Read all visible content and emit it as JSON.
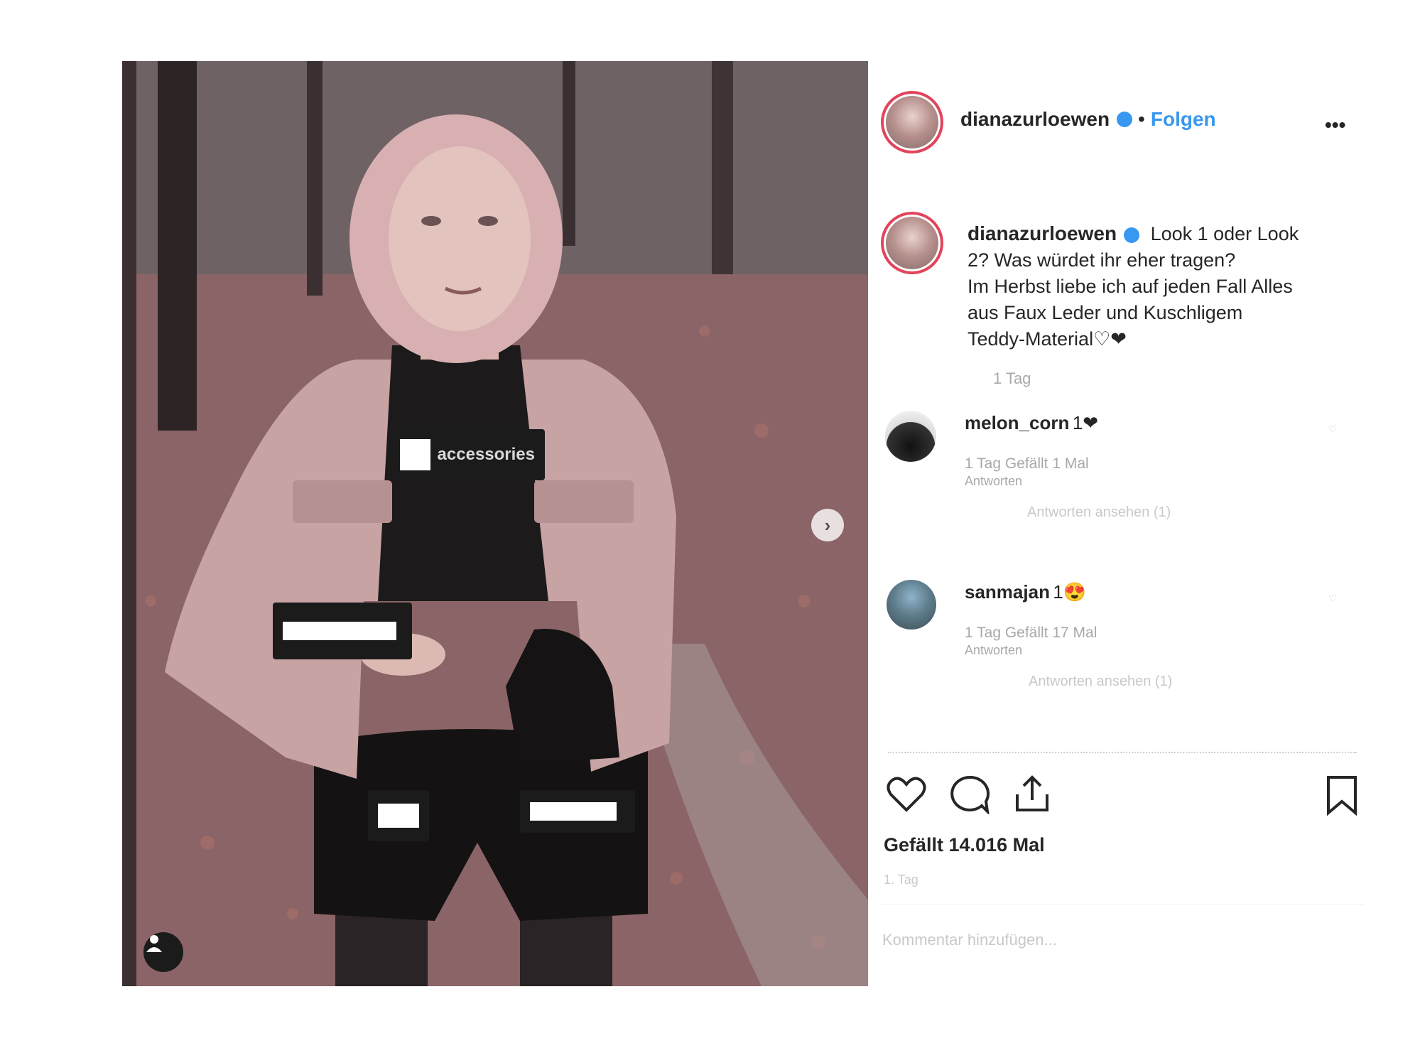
{
  "post": {
    "username": "dianazurloewen",
    "follow_label": "Folgen",
    "more_icon": "more-horizontal-icon",
    "caption_lines": [
      "Look 1 oder Look",
      "2? Was würdet ihr eher tragen?",
      "Im Herbst liebe ich auf jeden Fall Alles",
      "aus Faux Leder und Kuschligem",
      "Teddy-Material"
    ],
    "caption_emoji": "♡❤",
    "caption_time": "1 Tag",
    "likes": "Gefällt 14.016 Mal",
    "date": "1. Tag",
    "add_comment_placeholder": "Kommentar hinzufügen..."
  },
  "photo": {
    "tag_accessories": "accessories",
    "next_icon": "chevron-right-icon",
    "user_tag_icon": "person-icon"
  },
  "comments": [
    {
      "username": "melon_corn",
      "text": "1❤",
      "meta": "1 Tag   Gefällt 1 Mal",
      "reply": "Antworten",
      "view_replies": "Antworten ansehen (1)"
    },
    {
      "username": "sanmajan",
      "text": "1😍",
      "meta": "1 Tag   Gefällt 17 Mal",
      "reply": "Antworten",
      "view_replies": "Antworten ansehen (1)"
    }
  ],
  "colors": {
    "accent_blue": "#3897f0",
    "story_ring": "#e2445c"
  }
}
